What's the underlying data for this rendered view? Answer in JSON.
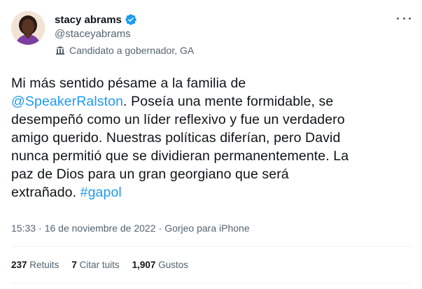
{
  "author": {
    "name": "stacy abrams",
    "handle": "@staceyabrams",
    "affiliation": "Candidato a gobernador, GA",
    "verified_color": "#1d9bf0"
  },
  "tweet": {
    "line1": "Mi más sentido pésame a la familia de",
    "line2_mention": "@SpeakerRalston",
    "line2_rest": ". Poseía una mente formidable, se",
    "line3": "desempeñó como un líder reflexivo y fue un verdadero",
    "line4": "amigo querido. Nuestras políticas diferían, pero David",
    "line5": "nunca permitió que se dividieran permanentemente. La",
    "line6": "paz de Dios para un gran georgiano que será",
    "line7_text": "extrañado. ",
    "line7_hashtag": "#gapol"
  },
  "meta": {
    "time": "15:33",
    "separator": "·",
    "date": "16 de noviembre de 2022",
    "source": "Gorjeo para iPhone"
  },
  "stats": {
    "retweets_count": "237",
    "retweets_label": "Retuits",
    "quotes_count": "7",
    "quotes_label": "Citar tuits",
    "likes_count": "1,907",
    "likes_label": "Gustos"
  },
  "icons": {
    "more": "more-horizontal-icon",
    "verified": "verified-badge-icon",
    "affiliation": "government-building-icon"
  },
  "colors": {
    "accent": "#1d9bf0",
    "secondary_text": "#536471",
    "primary_text": "#0f1419"
  }
}
